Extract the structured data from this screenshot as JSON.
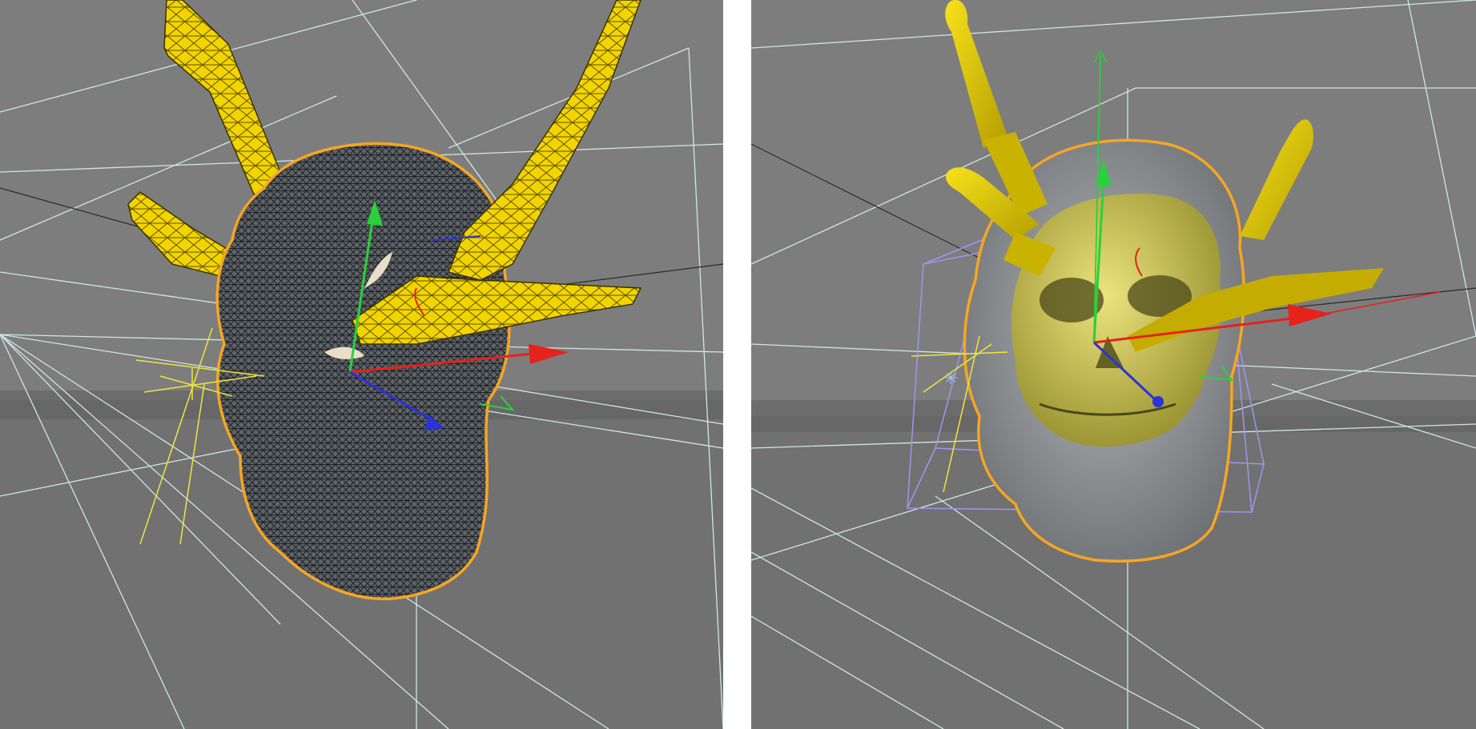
{
  "app": {
    "views": [
      {
        "id": "left",
        "mode": "wireframe"
      },
      {
        "id": "right",
        "mode": "shaded-xray"
      }
    ]
  },
  "colors": {
    "viewport_bg": "#7b7b7b",
    "floor": "#6f6f6f",
    "guide_line": "#cfe7e2",
    "selection_outline": "#f5a623",
    "knife_yellow": "#f2d400",
    "knife_edge": "#7a6a00",
    "head_dark": "#2f3236",
    "head_grey": "#8d9093",
    "skull_yellow": "#d8cf4a",
    "axis_x": "#e5221b",
    "axis_y": "#29d13b",
    "axis_z": "#2a33d6",
    "bbox": "#9f95f0"
  },
  "icons": {
    "light": "light-icon",
    "axis_gizmo": "axis-gizmo-icon"
  }
}
